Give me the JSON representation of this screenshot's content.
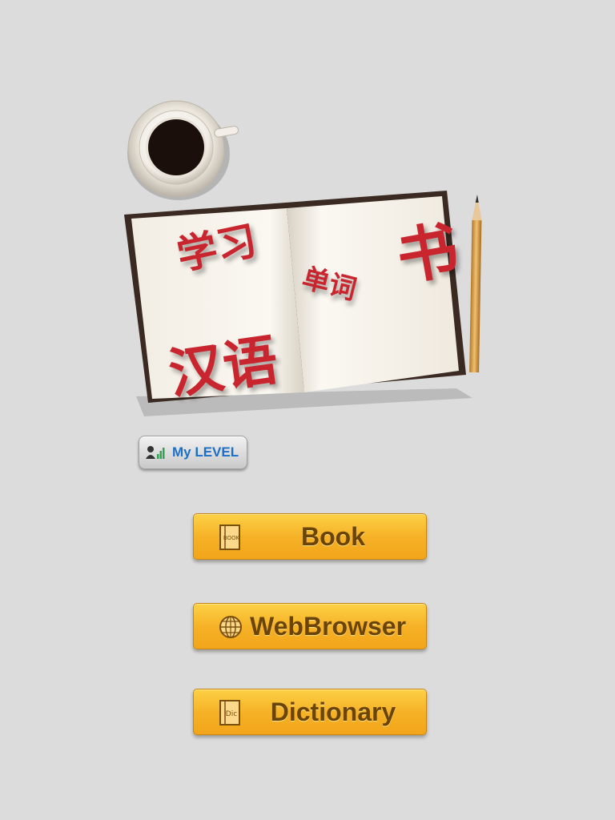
{
  "book_title": {
    "line1": "学习",
    "line2": "单词",
    "line3": "书",
    "line4": "汉语"
  },
  "level_button": {
    "label": "My LEVEL"
  },
  "buttons": [
    {
      "label": "Book",
      "icon": "book-icon",
      "icon_text": "BOOK"
    },
    {
      "label": "WebBrowser",
      "icon": "globe-icon"
    },
    {
      "label": "Dictionary",
      "icon": "dictionary-icon",
      "icon_text": "Dic"
    }
  ],
  "colors": {
    "title_red": "#c9252e",
    "button_orange": "#f6b227",
    "button_text": "#6b4409",
    "level_text": "#1a6fc8",
    "background": "#dcdcdc"
  }
}
